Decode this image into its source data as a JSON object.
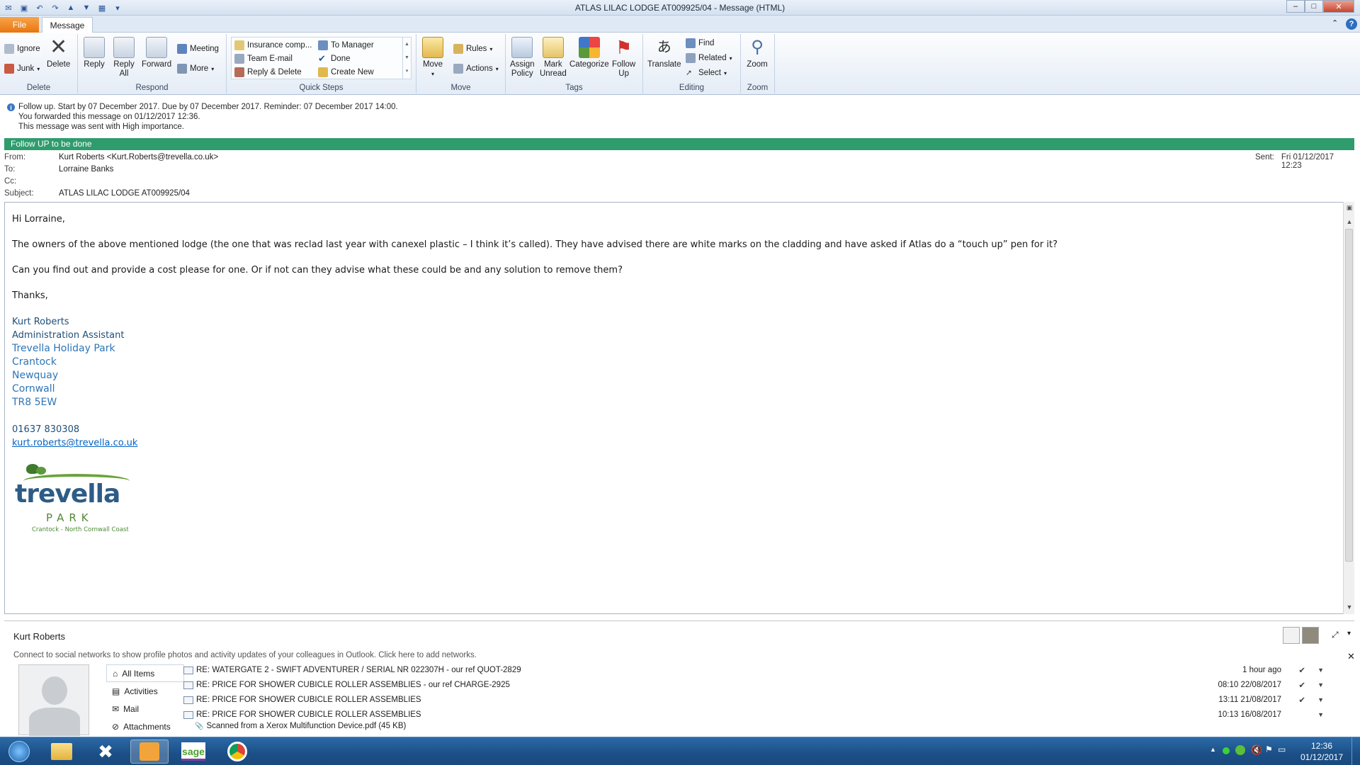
{
  "window": {
    "title": "ATLAS LILAC LODGE AT009925/04  -  Message (HTML)",
    "minimize": "–",
    "maximize": "□",
    "close": "✕"
  },
  "tabs": {
    "file": "File",
    "message": "Message",
    "help": "?",
    "collapse": "⌃"
  },
  "ribbon": {
    "delete": {
      "label": "Delete",
      "ignore": "Ignore",
      "junk": "Junk",
      "delete": "Delete"
    },
    "respond": {
      "label": "Respond",
      "reply": "Reply",
      "reply_all_1": "Reply",
      "reply_all_2": "All",
      "forward": "Forward",
      "meeting": "Meeting",
      "more": "More"
    },
    "quick_steps": {
      "label": "Quick Steps",
      "items": [
        "Insurance comp...",
        "To Manager",
        "Team E-mail",
        "Done",
        "Reply & Delete",
        "Create New"
      ]
    },
    "move": {
      "label": "Move",
      "move": "Move",
      "rules": "Rules",
      "actions": "Actions"
    },
    "tags": {
      "label": "Tags",
      "assign_1": "Assign",
      "assign_2": "Policy",
      "mark_1": "Mark",
      "mark_2": "Unread",
      "categorize": "Categorize",
      "follow_1": "Follow",
      "follow_2": "Up"
    },
    "editing": {
      "label": "Editing",
      "translate": "Translate",
      "find": "Find",
      "related": "Related",
      "select": "Select"
    },
    "zoom": {
      "label": "Zoom",
      "zoom": "Zoom"
    }
  },
  "info": {
    "lines": [
      "Follow up.  Start by 07 December 2017.  Due by 07 December 2017.  Reminder: 07 December 2017 14:00.",
      "You forwarded this message on 01/12/2017 12:36.",
      "This message was sent with High importance."
    ]
  },
  "follow_banner": "Follow UP to be done",
  "header": {
    "from_label": "From:",
    "from": "Kurt Roberts <Kurt.Roberts@trevella.co.uk>",
    "to_label": "To:",
    "to": "Lorraine Banks",
    "cc_label": "Cc:",
    "cc": "",
    "subject_label": "Subject:",
    "subject": "ATLAS LILAC LODGE AT009925/04",
    "sent_label": "Sent:",
    "sent": "Fri 01/12/2017 12:23"
  },
  "body": {
    "greeting": "Hi Lorraine,",
    "p1": "The owners of the above mentioned lodge (the one that was reclad last year with canexel plastic – I think it’s called). They have advised there are white marks on the cladding and have asked if Atlas do a “touch up” pen for it?",
    "p2": "Can you find out and provide a cost please for one. Or if not can they advise what these could be and any solution to remove them?",
    "thanks": "Thanks,",
    "sig_name": "Kurt Roberts",
    "sig_title": "Administration Assistant",
    "address": [
      "Trevella Holiday Park",
      "Crantock",
      "Newquay",
      "Cornwall",
      "TR8 5EW"
    ],
    "phone": "01637 830308",
    "email": "kurt.roberts@trevella.co.uk",
    "logo": {
      "word": "trevella",
      "sub": "PARK",
      "tag": "Crantock - North Cornwall Coast"
    }
  },
  "people": {
    "name": "Kurt Roberts",
    "social": "Connect to social networks to show profile photos and activity updates of your colleagues in Outlook. Click here to add networks.",
    "nav": [
      "All Items",
      "Activities",
      "Mail",
      "Attachments"
    ],
    "items": [
      {
        "subject": "RE: WATERGATE 2 - SWIFT ADVENTURER / SERIAL NR 022307H - our ref QUOT-2829",
        "time": "1 hour ago"
      },
      {
        "subject": "RE: PRICE FOR SHOWER CUBICLE ROLLER ASSEMBLIES - our ref CHARGE-2925",
        "time": "08:10  22/08/2017"
      },
      {
        "subject": "RE: PRICE FOR SHOWER CUBICLE ROLLER ASSEMBLIES",
        "time": "13:11  21/08/2017"
      },
      {
        "subject": "RE: PRICE FOR SHOWER CUBICLE ROLLER ASSEMBLIES",
        "time": "10:13  16/08/2017"
      }
    ],
    "attachment": "Scanned from a Xerox Multifunction Device.pdf (45 KB)"
  },
  "taskbar": {
    "time": "12:36",
    "date": "01/12/2017",
    "sage": "sage"
  },
  "colors": {
    "accent": "#2f9c6e",
    "file_tab": "#e9760f",
    "sig": "#1f4e79",
    "link": "#0563c1"
  }
}
